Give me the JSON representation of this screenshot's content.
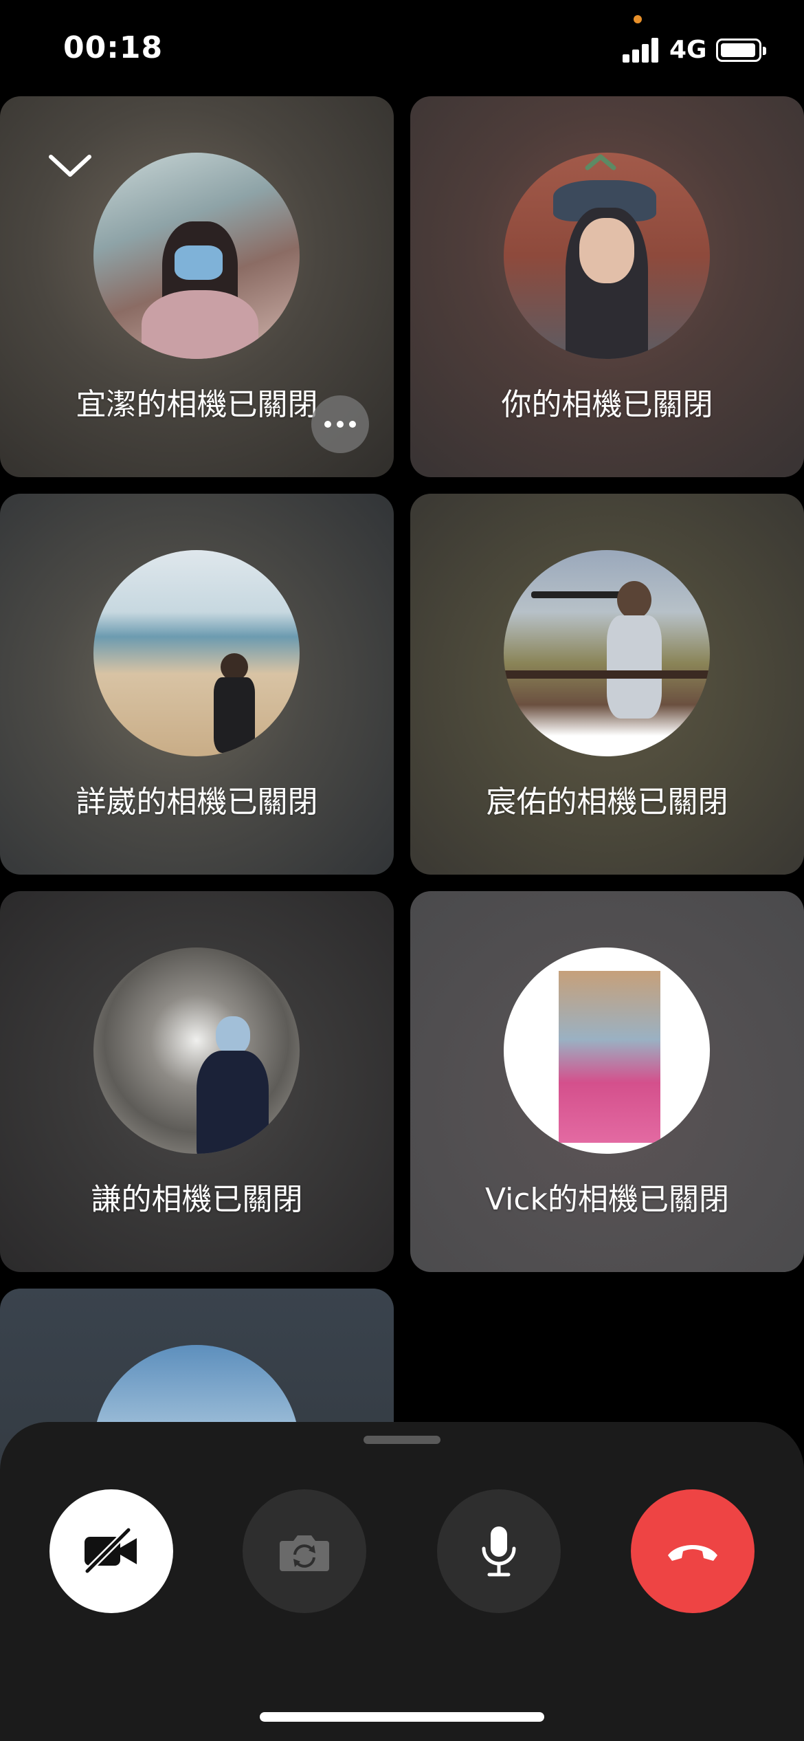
{
  "status_bar": {
    "time": "00:18",
    "network": "4G",
    "icons": [
      "signal-icon",
      "battery-icon"
    ]
  },
  "participants": [
    {
      "id": "p1",
      "label": "宜潔的相機已關閉",
      "avatar": "avatar-photo"
    },
    {
      "id": "p2",
      "label": "你的相機已關閉",
      "avatar": "avatar-photo"
    },
    {
      "id": "p3",
      "label": "詳崴的相機已關閉",
      "avatar": "avatar-photo"
    },
    {
      "id": "p4",
      "label": "宸佑的相機已關閉",
      "avatar": "avatar-photo"
    },
    {
      "id": "p5",
      "label": "謙的相機已關閉",
      "avatar": "avatar-photo"
    },
    {
      "id": "p6",
      "label": "Vick的相機已關閉",
      "avatar": "avatar-photo"
    },
    {
      "id": "p7",
      "label": "",
      "avatar": "avatar-photo"
    }
  ],
  "overlay_icons": {
    "collapse": "chevron-down-icon",
    "more": "more-options-icon"
  },
  "controls": [
    {
      "name": "camera-off-button",
      "icon": "video-off-icon"
    },
    {
      "name": "flip-camera-button",
      "icon": "flip-camera-icon"
    },
    {
      "name": "mute-button",
      "icon": "microphone-icon"
    },
    {
      "name": "end-call-button",
      "icon": "end-call-icon"
    }
  ],
  "colors": {
    "end_call": "#ee4444",
    "sheet": "#1b1b1b",
    "control_dark": "#2e2e2e"
  }
}
